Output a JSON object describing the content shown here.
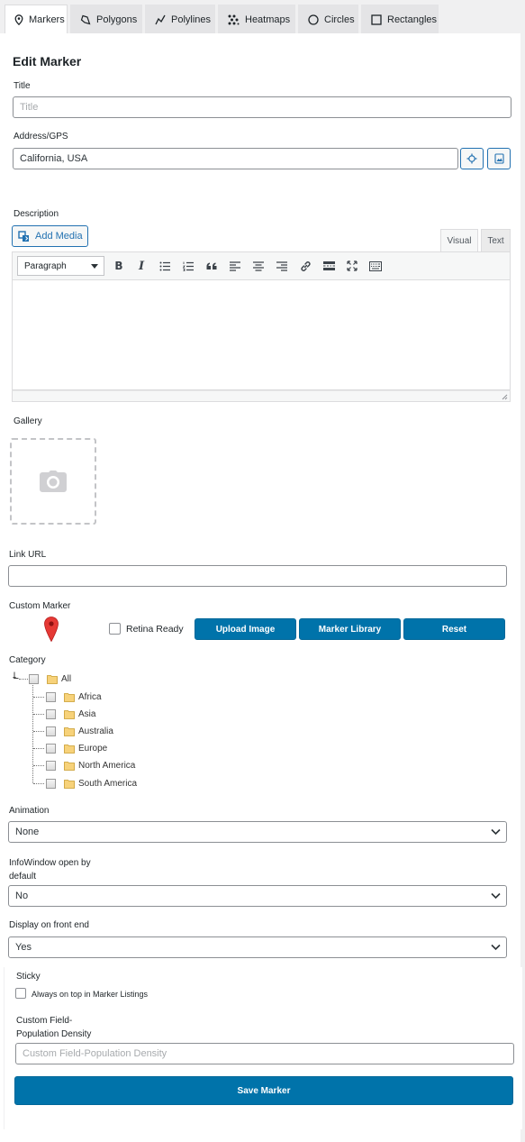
{
  "tabs": [
    {
      "label": "Markers",
      "icon": "marker-pin-icon",
      "active": true
    },
    {
      "label": "Polygons",
      "icon": "polygon-icon",
      "active": false
    },
    {
      "label": "Polylines",
      "icon": "polyline-icon",
      "active": false
    },
    {
      "label": "Heatmaps",
      "icon": "heatmap-icon",
      "active": false
    },
    {
      "label": "Circles",
      "icon": "circle-icon",
      "active": false
    },
    {
      "label": "Rectangles",
      "icon": "rectangle-icon",
      "active": false
    }
  ],
  "form": {
    "heading": "Edit Marker",
    "title_label": "Title",
    "title_placeholder": "Title",
    "title_value": "",
    "address_label": "Address/GPS",
    "address_value": "California, USA",
    "description_label": "Description",
    "add_media_label": "Add Media",
    "editor_tabs": {
      "visual": "Visual",
      "text": "Text"
    },
    "paragraph_format": "Paragraph",
    "toolbar_icons": [
      "bold-icon",
      "italic-icon",
      "bullet-list-icon",
      "numbered-list-icon",
      "blockquote-icon",
      "align-left-icon",
      "align-center-icon",
      "align-right-icon",
      "link-icon",
      "read-more-icon",
      "fullscreen-icon",
      "toolbar-toggle-icon"
    ],
    "gallery_label": "Gallery",
    "link_url_label": "Link URL",
    "link_url_value": "",
    "custom_marker_label": "Custom Marker",
    "retina_label": "Retina Ready",
    "upload_image_label": "Upload Image",
    "marker_library_label": "Marker Library",
    "reset_label": "Reset",
    "category_label": "Category",
    "category_root": "All",
    "categories": [
      "Africa",
      "Asia",
      "Australia",
      "Europe",
      "North America",
      "South America"
    ],
    "animation_label": "Animation",
    "animation_value": "None",
    "infowindow_label_line1": "InfoWindow open by",
    "infowindow_label_line2": "default",
    "infowindow_value": "No",
    "display_label": "Display on front end",
    "display_value": "Yes",
    "sticky_label": "Sticky",
    "sticky_option": "Always on top in Marker Listings",
    "custom_field_label_line1": "Custom Field-",
    "custom_field_label_line2": "Population Density",
    "custom_field_placeholder": "Custom Field-Population Density",
    "save_label": "Save Marker"
  },
  "colors": {
    "primary_button": "#0073aa",
    "accent_link": "#2271b1",
    "marker_pin": "#e53935",
    "tab_bar_bg": "#f0f0f1"
  }
}
